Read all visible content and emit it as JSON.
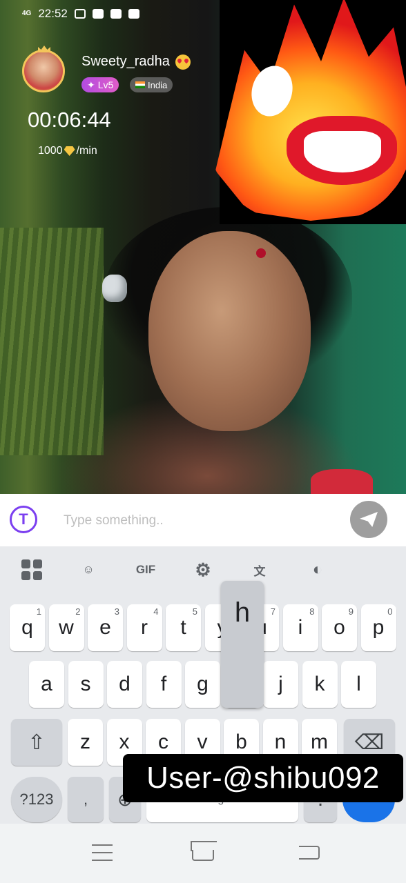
{
  "status_bar": {
    "network": "4G",
    "time": "22:52"
  },
  "profile": {
    "username": "Sweety_radha",
    "level_badge": "Lv5",
    "country": "India",
    "call_timer": "00:06:44",
    "rate_amount": "1000",
    "rate_unit": "/min"
  },
  "chat_input": {
    "placeholder": "Type something..",
    "value": ""
  },
  "keyboard": {
    "toolbar": [
      "apps-grid",
      "sticker",
      "GIF",
      "settings",
      "translate",
      "theme"
    ],
    "gif_label": "GIF",
    "row1": [
      {
        "key": "q",
        "hint": "1"
      },
      {
        "key": "w",
        "hint": "2"
      },
      {
        "key": "e",
        "hint": "3"
      },
      {
        "key": "r",
        "hint": "4"
      },
      {
        "key": "t",
        "hint": "5"
      },
      {
        "key": "y",
        "hint": "6"
      },
      {
        "key": "u",
        "hint": "7"
      },
      {
        "key": "i",
        "hint": "8"
      },
      {
        "key": "o",
        "hint": "9"
      },
      {
        "key": "p",
        "hint": "0"
      }
    ],
    "row2": [
      "a",
      "s",
      "d",
      "f",
      "g",
      "h",
      "j",
      "k",
      "l"
    ],
    "row3": [
      "z",
      "x",
      "c",
      "v",
      "b",
      "n",
      "m"
    ],
    "pressed_key": "h",
    "symbols_label": "?123",
    "comma_label": ",",
    "space_label": "English"
  },
  "watermark": "User-@shibu092",
  "colors": {
    "accent": "#7b3ff0",
    "enter": "#1a73e8",
    "level_badge": "#c24fd8"
  }
}
